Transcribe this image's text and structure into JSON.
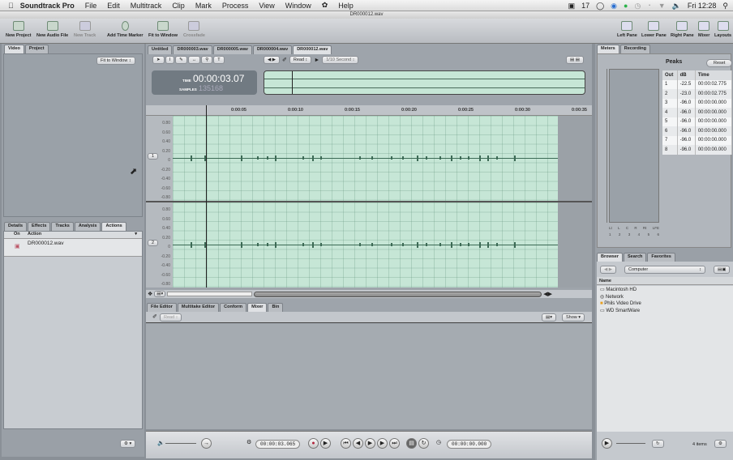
{
  "menubar": {
    "app": "Soundtrack Pro",
    "items": [
      "File",
      "Edit",
      "Multitrack",
      "Clip",
      "Mark",
      "Process",
      "View",
      "Window",
      "Script",
      "Help"
    ],
    "date_num": "17",
    "clock": "Fri 12:28"
  },
  "window_title": "DR000012.wav",
  "toolbar": {
    "left": [
      "New Project",
      "New Audio File",
      "New Track",
      "Add Time Marker",
      "Fit to Window",
      "Crossfade"
    ],
    "right": [
      "Left Pane",
      "Lower Pane",
      "Right Pane",
      "Mixer",
      "Layouts"
    ]
  },
  "left_panel": {
    "tabs": [
      "Video",
      "Project"
    ],
    "fit_select": "Fit to Window",
    "lower_tabs": [
      "Details",
      "Effects",
      "Tracks",
      "Analysis",
      "Actions"
    ],
    "actions_cols": [
      "On",
      "Action"
    ],
    "actions_rows": [
      "DR000012.wav"
    ]
  },
  "center": {
    "file_tabs": [
      "Untitled",
      "DR000003.wav",
      "DR000005.wav",
      "DR000004.wav",
      "DR000012.wav"
    ],
    "automation_mode": "Read",
    "snap": "1/10 Second",
    "time_label": "TIME",
    "timecode": "00:00:03.07",
    "sample_label": "SAMPLES",
    "samples": "135168",
    "ruler": [
      "0:00:05",
      "0:00:10",
      "0:00:15",
      "0:00:20",
      "0:00:25",
      "0:00:30",
      "0:00:35"
    ],
    "axis": [
      "0.80",
      "0.60",
      "0.40",
      "0.20",
      "0",
      "-0.20",
      "-0.40",
      "-0.60",
      "-0.80"
    ],
    "tracks": [
      "1",
      "2"
    ],
    "lower_tabs": [
      "File Editor",
      "Multitake Editor",
      "Conform",
      "Mixer",
      "Bin"
    ],
    "lower_mode": "Read",
    "show": "Show"
  },
  "transport": {
    "playhead": "00:00:03.065",
    "duration": "00:00:00.000"
  },
  "right_panel": {
    "tabs": [
      "Meters",
      "Recording"
    ],
    "peaks_title": "Peaks",
    "reset": "Reset",
    "peaks_cols": [
      "Out",
      "dB",
      "Time"
    ],
    "peaks": [
      [
        "1",
        "-22.5",
        "00:00:02.775"
      ],
      [
        "2",
        "-23.0",
        "00:00:02.775"
      ],
      [
        "3",
        "-96.0",
        "00:00:00.000"
      ],
      [
        "4",
        "-96.0",
        "00:00:00.000"
      ],
      [
        "5",
        "-96.0",
        "00:00:00.000"
      ],
      [
        "6",
        "-96.0",
        "00:00:00.000"
      ],
      [
        "7",
        "-96.0",
        "00:00:00.000"
      ],
      [
        "8",
        "-96.0",
        "00:00:00.000"
      ]
    ],
    "meter_labels": [
      "Lt",
      "L",
      "C",
      "R",
      "Rt",
      "LFE"
    ],
    "meter_nums": [
      "1",
      "2",
      "3",
      "4",
      "5",
      "6"
    ],
    "browser_tabs": [
      "Browser",
      "Search",
      "Favorites"
    ],
    "location": "Computer",
    "name_col": "Name",
    "items": [
      "Macintosh HD",
      "Network",
      "Phils Video Drive",
      "WD SmartWare"
    ],
    "count": "4 items"
  }
}
